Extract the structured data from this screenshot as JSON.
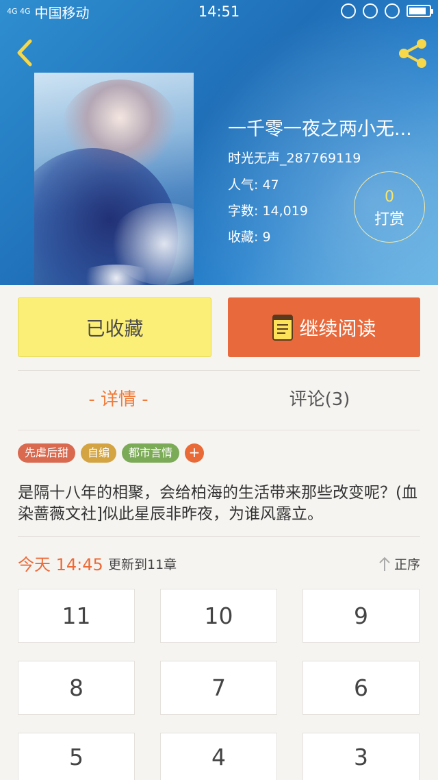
{
  "status_bar": {
    "signal": "4G 4G",
    "carrier": "中国移动",
    "time": "14:51"
  },
  "book": {
    "title": "一千零一夜之两小无...",
    "author": "时光无声_287769119",
    "popularity_label": "人气: 47",
    "words_label": "字数: 14,019",
    "favorites_label": "收藏: 9",
    "reward_count": "0",
    "reward_label": "打赏"
  },
  "actions": {
    "collected_label": "已收藏",
    "read_label": "继续阅读"
  },
  "tabs": {
    "detail": "- 详情 -",
    "comments": "评论(3)"
  },
  "tags": [
    {
      "label": "先虐后甜",
      "color": "#d9694f"
    },
    {
      "label": "自编",
      "color": "#d3a441"
    },
    {
      "label": "都市言情",
      "color": "#7cab57"
    }
  ],
  "tag_add": "+",
  "description": "是隔十八年的相聚，会给柏海的生活带来那些改变呢？(血染蔷薇文社]似此星辰非昨夜，为谁风露立。",
  "update": {
    "today": "今天 14:45",
    "text": "更新到11章",
    "sort_label": "正序"
  },
  "chapters": [
    "11",
    "10",
    "9",
    "8",
    "7",
    "6",
    "5",
    "4",
    "3"
  ],
  "colors": {
    "accent_orange": "#e8693b",
    "collected_yellow": "#fbef78"
  }
}
